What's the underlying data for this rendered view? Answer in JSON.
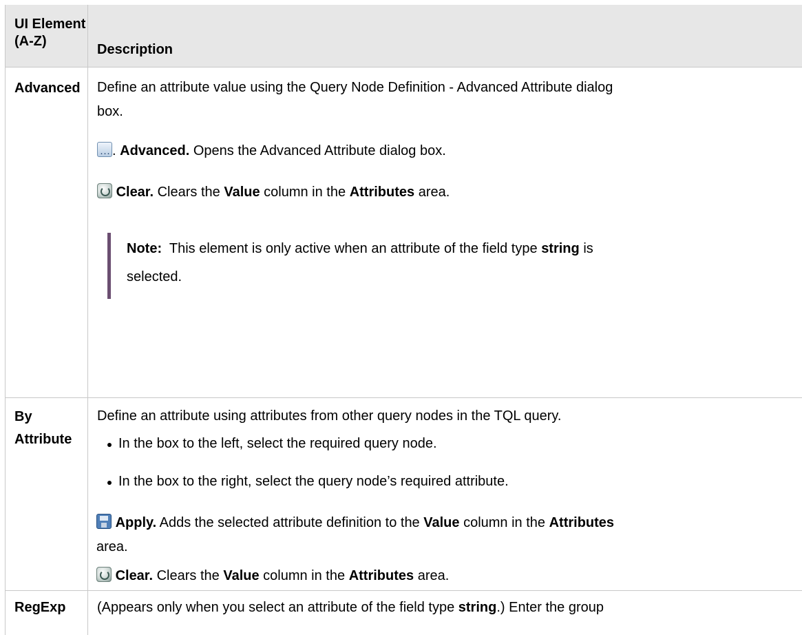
{
  "table": {
    "headers": {
      "ui_element_line1": "UI Element",
      "ui_element_line2": "(A-Z)",
      "description": "Description"
    },
    "rows": [
      {
        "element": "Advanced",
        "intro": "Define an attribute value using the Query Node Definition - Advanced Attribute dialog",
        "intro_cont": "box.",
        "advanced_dot": ".",
        "advanced_bold": "Advanced.",
        "advanced_text": "Opens the Advanced Attribute dialog box.",
        "clear_bold": "Clear.",
        "clear_text_1": "Clears the",
        "clear_value": "Value",
        "clear_text_2": "column in the",
        "clear_attributes": "Attributes",
        "clear_text_3": "area.",
        "note_label": "Note:",
        "note_text_1": "This element is only active when an attribute of the field type",
        "note_string": "string",
        "note_text_2": "is",
        "note_cont": "selected."
      },
      {
        "element_line1": "By",
        "element_line2": "Attribute",
        "intro": "Define an attribute using attributes from other query nodes in the TQL query.",
        "bullets": [
          "In the box to the left, select the required query node.",
          "In the box to the right, select the query node’s required attribute."
        ],
        "apply_bold": "Apply.",
        "apply_text_1": "Adds the selected attribute definition to the",
        "apply_value": "Value",
        "apply_text_2": "column in the",
        "apply_attributes": "Attributes",
        "apply_cont": "area.",
        "clear_bold": "Clear.",
        "clear_text_1": "Clears the",
        "clear_value": "Value",
        "clear_text_2": "column in the",
        "clear_attributes": "Attributes",
        "clear_text_3": "area."
      },
      {
        "element": "RegExp",
        "text_1": "(Appears only when you select an attribute of the field type",
        "text_string": "string",
        "text_2": ".) Enter the group"
      }
    ]
  },
  "icons": {
    "advanced": "ellipsis-button-icon",
    "clear": "clear-refresh-icon",
    "apply": "save-floppy-icon"
  }
}
